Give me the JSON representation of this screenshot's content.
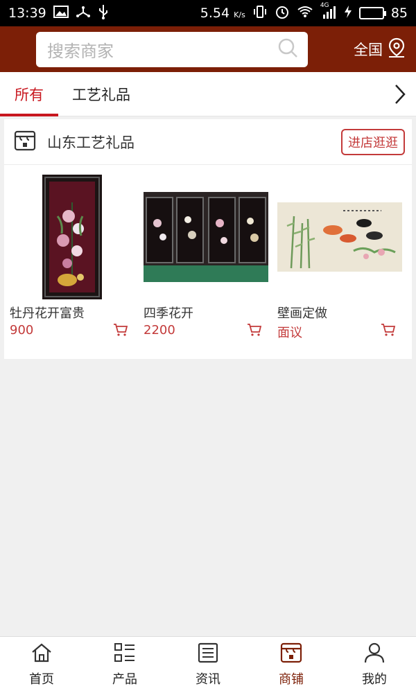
{
  "status_bar": {
    "time": "13:39",
    "speed": "5.54",
    "speed_unit": "K/s",
    "network": "4G",
    "battery": "85",
    "battery_level": 0.85
  },
  "header": {
    "search_placeholder": "搜索商家",
    "region": "全国"
  },
  "tabs": [
    {
      "label": "所有",
      "active": true
    },
    {
      "label": "工艺礼品",
      "active": false
    }
  ],
  "shop": {
    "name": "山东工艺礼品",
    "visit_label": "进店逛逛",
    "products": [
      {
        "name": "牡丹花开富贵",
        "price": "900"
      },
      {
        "name": "四季花开",
        "price": "2200"
      },
      {
        "name": "壁画定做",
        "price": "面议"
      }
    ]
  },
  "bottom_nav": [
    {
      "label": "首页",
      "icon": "home-icon",
      "active": false
    },
    {
      "label": "产品",
      "icon": "product-grid-icon",
      "active": false
    },
    {
      "label": "资讯",
      "icon": "news-icon",
      "active": false
    },
    {
      "label": "商铺",
      "icon": "shop-icon",
      "active": true
    },
    {
      "label": "我的",
      "icon": "user-icon",
      "active": false
    }
  ],
  "colors": {
    "brand": "#7c1f07",
    "accent": "#c8171f",
    "price": "#c33a3a"
  }
}
